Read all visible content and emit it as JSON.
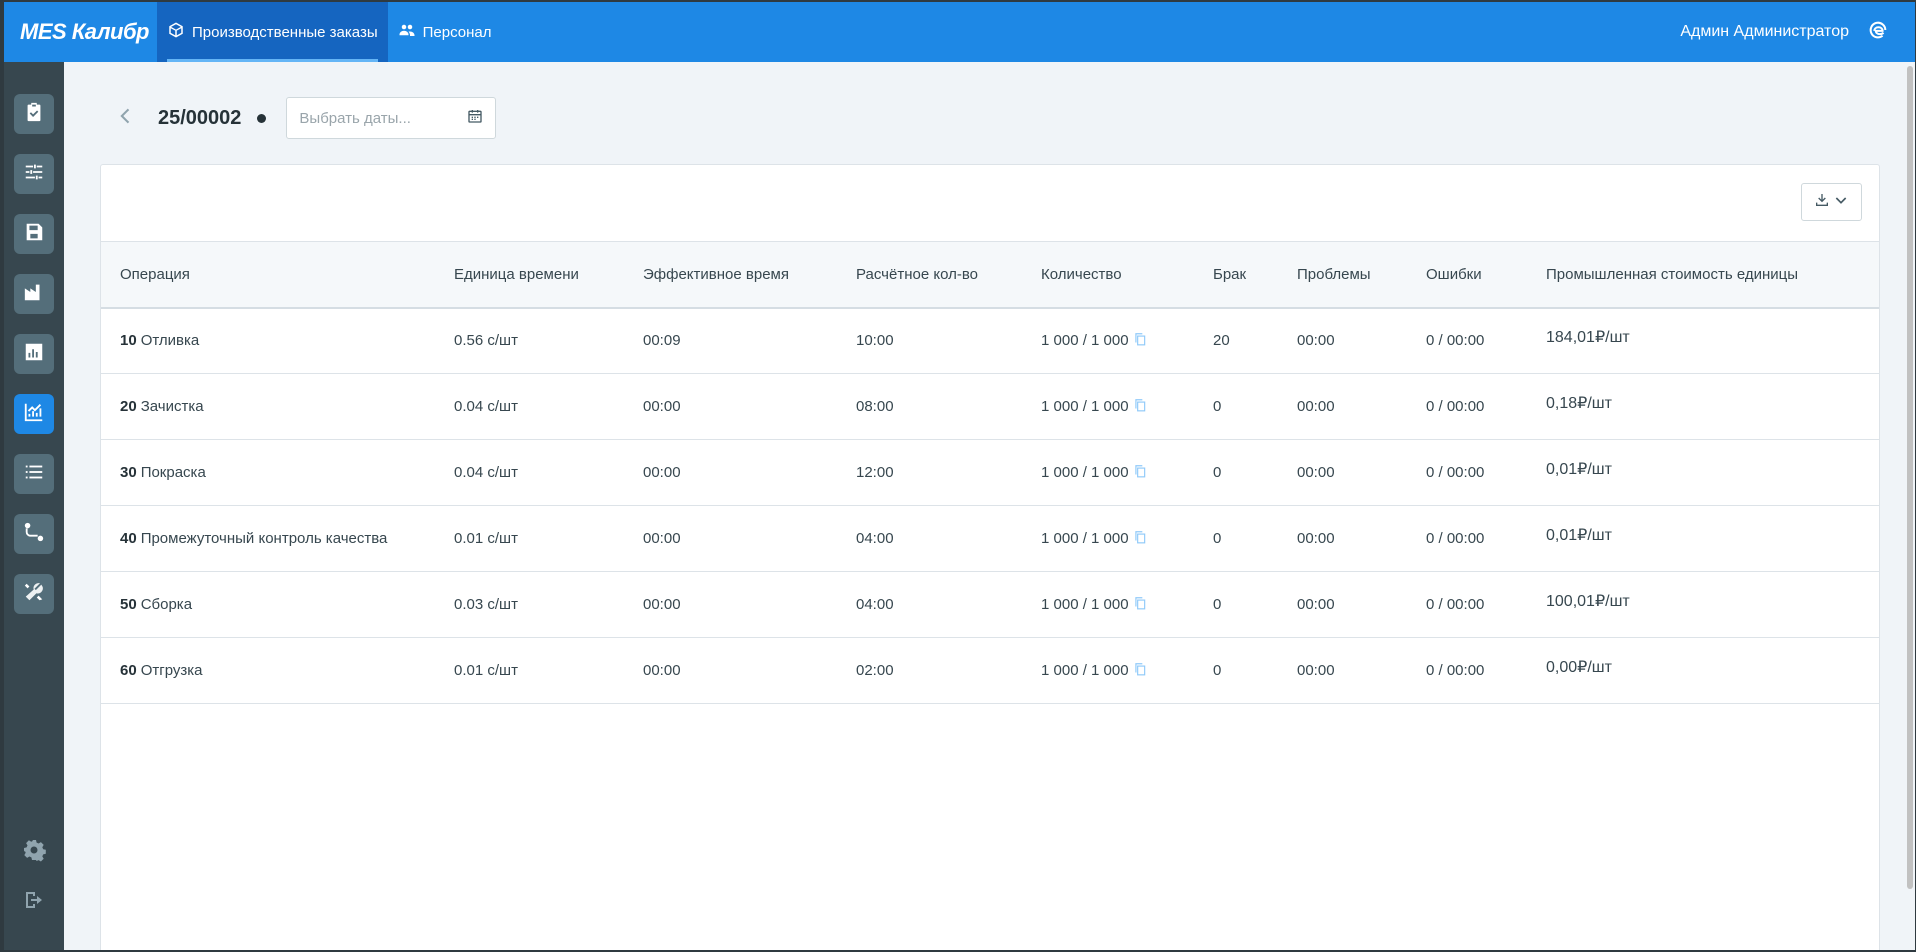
{
  "app": {
    "brand": "MES Калибр",
    "nav": [
      {
        "label": "Производственные заказы",
        "icon": "cube-icon",
        "active": true
      },
      {
        "label": "Персонал",
        "icon": "users-icon",
        "active": false
      }
    ],
    "user_name": "Админ Администратор"
  },
  "sidebar": {
    "items": [
      {
        "icon": "clipboard-check-icon"
      },
      {
        "icon": "sliders-icon"
      },
      {
        "icon": "save-icon"
      },
      {
        "icon": "factory-icon"
      },
      {
        "icon": "bar-chart-icon"
      },
      {
        "icon": "line-chart-icon",
        "active": true
      },
      {
        "icon": "list-icon"
      },
      {
        "icon": "route-icon"
      },
      {
        "icon": "tools-icon"
      }
    ],
    "bottom": [
      {
        "icon": "gear-icon"
      },
      {
        "icon": "logout-icon"
      }
    ]
  },
  "page": {
    "order_number": "25/00002",
    "date_placeholder": "Выбрать даты..."
  },
  "table": {
    "headers": {
      "operation": "Операция",
      "time_unit": "Единица времени",
      "effective_time": "Эффективное время",
      "calc_qty": "Расчётное кол-во",
      "quantity": "Количество",
      "defect": "Брак",
      "problems": "Проблемы",
      "errors": "Ошибки",
      "unit_cost": "Промышленная стоимость единицы"
    },
    "rows": [
      {
        "num": "10",
        "name": "Отливка",
        "time_unit": "0.56 с/шт",
        "effective_time": "00:09",
        "calc_qty": "10:00",
        "quantity": "1 000 / 1 000",
        "defect": "20",
        "problems": "00:00",
        "errors": "0 / 00:00",
        "unit_cost": "184,01₽/шт"
      },
      {
        "num": "20",
        "name": "Зачистка",
        "time_unit": "0.04 с/шт",
        "effective_time": "00:00",
        "calc_qty": "08:00",
        "quantity": "1 000 / 1 000",
        "defect": "0",
        "problems": "00:00",
        "errors": "0 / 00:00",
        "unit_cost": "0,18₽/шт"
      },
      {
        "num": "30",
        "name": "Покраска",
        "time_unit": "0.04 с/шт",
        "effective_time": "00:00",
        "calc_qty": "12:00",
        "quantity": "1 000 / 1 000",
        "defect": "0",
        "problems": "00:00",
        "errors": "0 / 00:00",
        "unit_cost": "0,01₽/шт"
      },
      {
        "num": "40",
        "name": "Промежуточный контроль качества",
        "time_unit": "0.01 с/шт",
        "effective_time": "00:00",
        "calc_qty": "04:00",
        "quantity": "1 000 / 1 000",
        "defect": "0",
        "problems": "00:00",
        "errors": "0 / 00:00",
        "unit_cost": "0,01₽/шт"
      },
      {
        "num": "50",
        "name": "Сборка",
        "time_unit": "0.03 с/шт",
        "effective_time": "00:00",
        "calc_qty": "04:00",
        "quantity": "1 000 / 1 000",
        "defect": "0",
        "problems": "00:00",
        "errors": "0 / 00:00",
        "unit_cost": "100,01₽/шт"
      },
      {
        "num": "60",
        "name": "Отгрузка",
        "time_unit": "0.01 с/шт",
        "effective_time": "00:00",
        "calc_qty": "02:00",
        "quantity": "1 000 / 1 000",
        "defect": "0",
        "problems": "00:00",
        "errors": "0 / 00:00",
        "unit_cost": "0,00₽/шт"
      }
    ]
  },
  "colors": {
    "topbar": "#1e88e5",
    "sidebar": "#37474f",
    "accent": "#1e88e5"
  }
}
